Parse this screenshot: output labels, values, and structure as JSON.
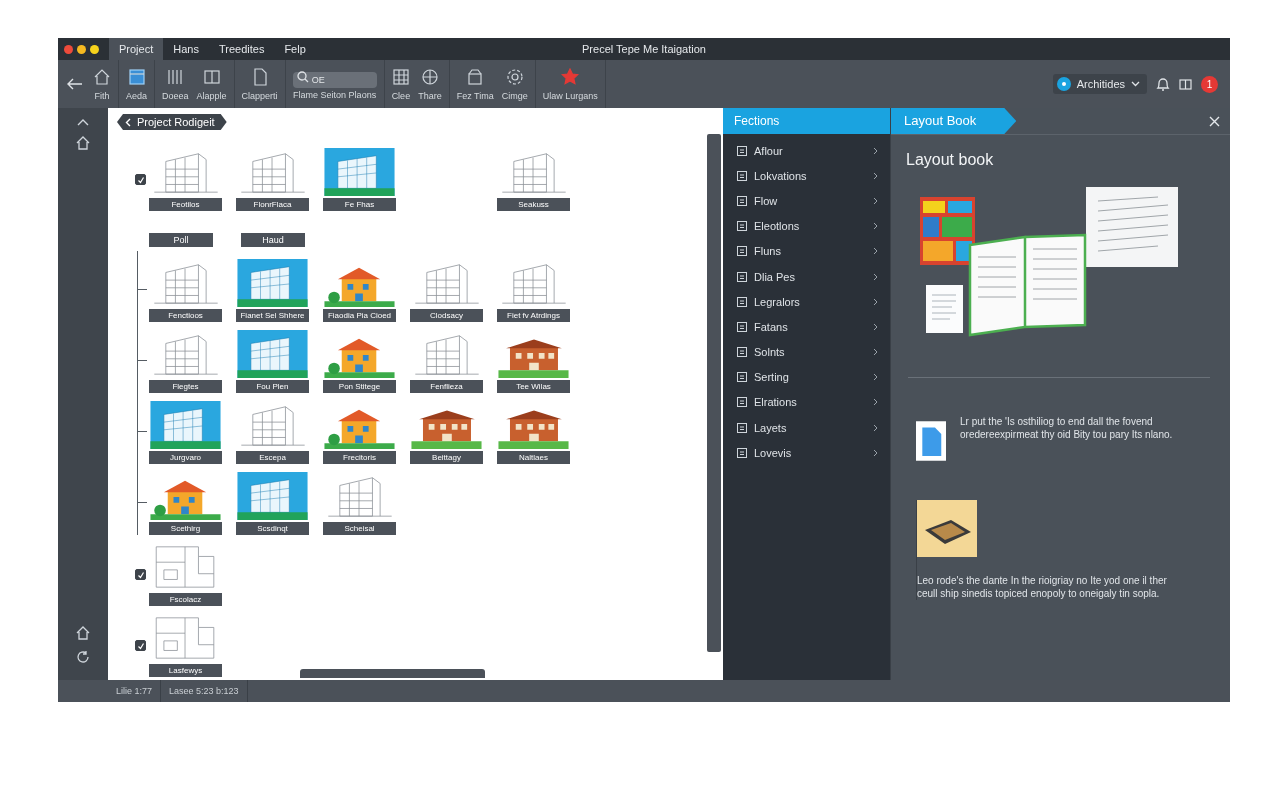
{
  "window": {
    "title": "Precel Tepe Me Itaigation"
  },
  "menu": [
    {
      "label": "Project",
      "selected": true
    },
    {
      "label": "Hans",
      "selected": false
    },
    {
      "label": "Treedites",
      "selected": false
    },
    {
      "label": "Felp",
      "selected": false
    }
  ],
  "toolbar": {
    "groups": [
      [
        {
          "kind": "back"
        },
        {
          "kind": "button",
          "label": "Fith"
        }
      ],
      [
        {
          "kind": "button",
          "label": "Aeda"
        }
      ],
      [
        {
          "kind": "button",
          "label": "Doeea"
        },
        {
          "kind": "button",
          "label": "Alapple"
        }
      ],
      [
        {
          "kind": "button",
          "label": "Clapperti"
        }
      ],
      [
        {
          "kind": "search",
          "placeholder": "OE",
          "label": "Flame Seiton Plaons"
        }
      ],
      [
        {
          "kind": "button",
          "label": "Clee"
        },
        {
          "kind": "button",
          "label": "Thare"
        }
      ],
      [
        {
          "kind": "button",
          "label": "Fez Tima"
        },
        {
          "kind": "button",
          "label": "Cimge"
        }
      ],
      [
        {
          "kind": "button",
          "label": "Ulaw Lurgans"
        }
      ]
    ],
    "workspace": "Architides",
    "badge": "1"
  },
  "canvas": {
    "breadcrumb": "Project Rodigeit",
    "top_row": {
      "checked": true,
      "thumbnails": [
        {
          "label": "Feotilos",
          "kind": "sketch"
        },
        {
          "label": "FlonrFlaca",
          "kind": "sketch"
        },
        {
          "label": "Fe Fhas",
          "kind": "sky"
        },
        {
          "label": "Seakuss",
          "kind": "sketch"
        }
      ]
    },
    "group": {
      "labels": [
        "Poll",
        "Haud"
      ],
      "rows": [
        [
          {
            "label": "Fenctioos",
            "kind": "sketch"
          },
          {
            "label": "Fianet Sel Shhere",
            "kind": "sky"
          },
          {
            "label": "Fiaodia Pia Cioed",
            "kind": "house"
          },
          {
            "label": "Clodsacy",
            "kind": "sketch"
          },
          {
            "label": "Fiet fv Atrdings",
            "kind": "sketch"
          }
        ],
        [
          {
            "label": "Flegtes",
            "kind": "sketch"
          },
          {
            "label": "Fou Plen",
            "kind": "sky"
          },
          {
            "label": "Pon Stitege",
            "kind": "house"
          },
          {
            "label": "Fenflieza",
            "kind": "sketch"
          },
          {
            "label": "Tee Wilas",
            "kind": "brick"
          }
        ],
        [
          {
            "label": "Jurgvaro",
            "kind": "sky"
          },
          {
            "label": "Escepa",
            "kind": "sketch"
          },
          {
            "label": "Frecitoris",
            "kind": "house"
          },
          {
            "label": "Beittagy",
            "kind": "brick"
          },
          {
            "label": "Naltlaes",
            "kind": "brick"
          }
        ],
        [
          {
            "label": "Scethirg",
            "kind": "house"
          },
          {
            "label": "Scsdinqt",
            "kind": "sky"
          },
          {
            "label": "Scheisal",
            "kind": "sketch"
          }
        ]
      ]
    },
    "bottom_rows": [
      {
        "checked": true,
        "thumbnails": [
          {
            "label": "Fscolacz",
            "kind": "sketch"
          }
        ]
      },
      {
        "checked": true,
        "thumbnails": [
          {
            "label": "Lasfewys",
            "kind": "sketch"
          }
        ]
      }
    ]
  },
  "sections": {
    "title": "Fections",
    "items": [
      "Aflour",
      "Lokvations",
      "Flow",
      "Eleotlons",
      "Fluns",
      "Dlia Pes",
      "Legralors",
      "Fatans",
      "Solnts",
      "Serting",
      "Elrations",
      "Layets",
      "Lovevis"
    ]
  },
  "layout_book": {
    "tab": "Layout Book",
    "heading": "Layout book",
    "notes": [
      {
        "kind": "document",
        "text": "Lr put the 'Is osthiliog to end dall the fovend oredereexpirmeat thy oid Bity tou pary Its nlano."
      },
      {
        "kind": "book",
        "text": "Leo rode's the dante In the rioigriay no Ite yod one il ther ceull ship sinedis topiced enopoly to oneigaly tin sopla."
      }
    ]
  },
  "status_bar": [
    "Lilie 1:77",
    "Lasee 5:23 b:123"
  ]
}
